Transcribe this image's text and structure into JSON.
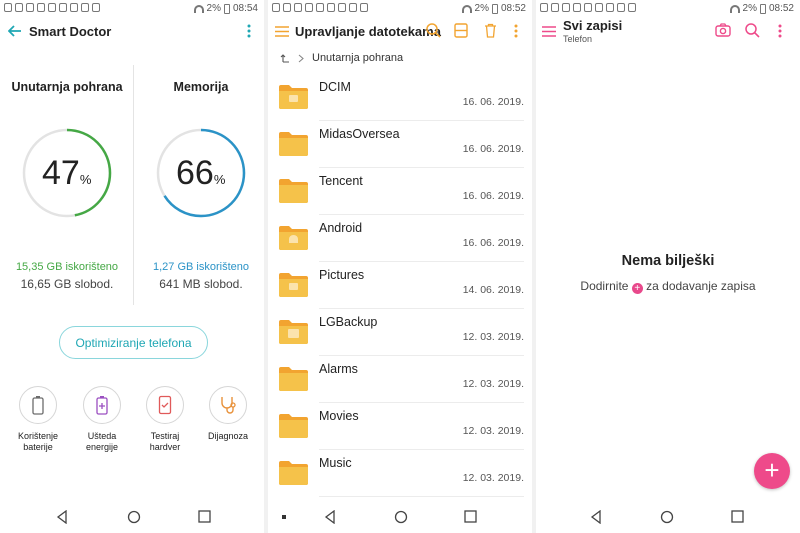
{
  "status": {
    "left_panel": {
      "battery": "2%",
      "time": "08:54"
    },
    "middle_panel": {
      "battery": "2%",
      "time": "08:52"
    },
    "right_panel": {
      "battery": "2%",
      "time": "08:52"
    }
  },
  "smart_doctor": {
    "title": "Smart Doctor",
    "internal": {
      "label": "Unutarnja pohrana",
      "percent": "47",
      "percent_unit": "%",
      "percent_value": 47,
      "used": "15,35 GB iskorišteno",
      "free": "16,65 GB slobod.",
      "color": "#45a845"
    },
    "memory": {
      "label": "Memorija",
      "percent": "66",
      "percent_unit": "%",
      "percent_value": 66,
      "used": "1,27 GB iskorišteno",
      "free": "641 MB slobod.",
      "color": "#2b93c7"
    },
    "optimize_button": "Optimiziranje telefona",
    "tools": [
      {
        "icon": "battery-icon",
        "label1": "Korištenje",
        "label2": "baterije"
      },
      {
        "icon": "battery-saver-icon",
        "label1": "Ušteda",
        "label2": "energije"
      },
      {
        "icon": "phone-check-icon",
        "label1": "Testiraj",
        "label2": "hardver"
      },
      {
        "icon": "stethoscope-icon",
        "label1": "Dijagnoza",
        "label2": ""
      }
    ]
  },
  "file_manager": {
    "title": "Upravljanje datotekama",
    "breadcrumb": "Unutarnja pohrana",
    "accent": "#f2a430",
    "folders": [
      {
        "name": "DCIM",
        "date": "16. 06. 2019.",
        "badge": "image"
      },
      {
        "name": "MidasOversea",
        "date": "16. 06. 2019.",
        "badge": ""
      },
      {
        "name": "Tencent",
        "date": "16. 06. 2019.",
        "badge": ""
      },
      {
        "name": "Android",
        "date": "16. 06. 2019.",
        "badge": "android"
      },
      {
        "name": "Pictures",
        "date": "14. 06. 2019.",
        "badge": "image"
      },
      {
        "name": "LGBackup",
        "date": "12. 03. 2019.",
        "badge": "backup"
      },
      {
        "name": "Alarms",
        "date": "12. 03. 2019.",
        "badge": ""
      },
      {
        "name": "Movies",
        "date": "12. 03. 2019.",
        "badge": ""
      },
      {
        "name": "Music",
        "date": "12. 03. 2019.",
        "badge": ""
      }
    ]
  },
  "notes": {
    "title": "Svi zapisi",
    "subtitle": "Telefon",
    "empty_title": "Nema bilješki",
    "hint_before": "Dodirnite",
    "hint_after": "za dodavanje zapisa",
    "accent": "#ee4a8a"
  }
}
